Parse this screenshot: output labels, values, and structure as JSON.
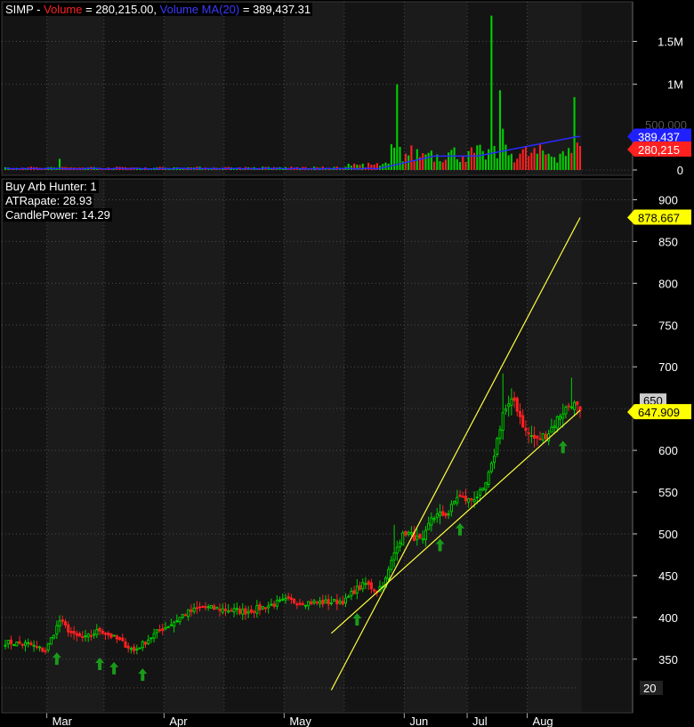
{
  "header": {
    "symbol": "SIMP",
    "sep": " - ",
    "volume_label": "Volume",
    "eq1": " = ",
    "volume_value": "280,215.00",
    "comma": ", ",
    "ma_label": "Volume MA(20)",
    "eq2": " = ",
    "ma_value": "389,437.31"
  },
  "indicators": {
    "buy_arb": "Buy Arb Hunter: 1",
    "atr": "ATRapate: 28.93",
    "candle": "CandlePower: 14.29"
  },
  "colors": {
    "up": "#00d000",
    "down": "#ff2020",
    "ma": "#2a2aff",
    "trend": "#ffff40",
    "arrow": "#1a9a1a",
    "grid": "#4a4a4a",
    "pane_bg": "#141414",
    "alt_bg": "#1b1b1b",
    "tag_last": "#ffff00",
    "tag_vol_up": "#ff2020",
    "tag_ma": "#2020ff"
  },
  "chart_data": [
    {
      "type": "bar",
      "title": "Volume",
      "y_ticks": [
        "1.5M",
        "1M",
        "0"
      ],
      "y_tick_values": [
        1500000,
        1000000,
        0
      ],
      "ylim": [
        0,
        1900000
      ],
      "series": [
        {
          "name": "Volume",
          "last": 280215
        },
        {
          "name": "Volume MA(20)",
          "last": 389437.31
        }
      ],
      "tags": {
        "partial": "500,000",
        "ma": "389,437",
        "vol": "280,215"
      },
      "note_values": {
        "vol_ma_start": 10000,
        "vol_ma_end": 389437
      }
    },
    {
      "type": "candlestick",
      "y_ticks": [
        "900",
        "850",
        "800",
        "750",
        "700",
        "650",
        "600",
        "550",
        "500",
        "450",
        "400",
        "350"
      ],
      "y_tick_values": [
        900,
        850,
        800,
        750,
        700,
        650,
        600,
        550,
        500,
        450,
        400,
        350
      ],
      "ylim": [
        305,
        925
      ],
      "x_labels": [
        "Mar",
        "Apr",
        "May",
        "Jun",
        "Jul",
        "Aug"
      ],
      "last_close": 647.909,
      "upper_trend_end": 878.667,
      "tags": {
        "upper": "878.667",
        "grey": "650",
        "last": "647.909",
        "bottom": "20"
      },
      "anchors": [
        [
          0,
          370
        ],
        [
          8,
          368
        ],
        [
          14,
          360
        ],
        [
          19,
          396
        ],
        [
          24,
          378
        ],
        [
          28,
          375
        ],
        [
          33,
          385
        ],
        [
          40,
          372
        ],
        [
          45,
          360
        ],
        [
          49,
          371
        ],
        [
          54,
          385
        ],
        [
          58,
          392
        ],
        [
          63,
          405
        ],
        [
          69,
          412
        ],
        [
          75,
          410
        ],
        [
          84,
          407
        ],
        [
          90,
          412
        ],
        [
          98,
          420
        ],
        [
          106,
          418
        ],
        [
          113,
          418
        ],
        [
          119,
          420
        ],
        [
          122,
          432
        ],
        [
          126,
          440
        ],
        [
          130,
          432
        ],
        [
          133,
          445
        ],
        [
          137,
          488
        ],
        [
          140,
          502
        ],
        [
          146,
          490
        ],
        [
          149,
          520
        ],
        [
          155,
          525
        ],
        [
          158,
          545
        ],
        [
          162,
          540
        ],
        [
          167,
          550
        ],
        [
          170,
          580
        ],
        [
          174,
          645
        ],
        [
          178,
          660
        ],
        [
          182,
          622
        ],
        [
          186,
          612
        ],
        [
          190,
          622
        ],
        [
          194,
          643
        ],
        [
          198,
          657
        ],
        [
          201,
          648
        ]
      ],
      "arrows_bar_index": [
        18,
        33,
        38,
        48,
        123,
        152,
        159,
        195
      ],
      "trendlines": [
        {
          "name": "upper",
          "from": [
            114,
            313
          ],
          "to": [
            201,
            878.667
          ]
        },
        {
          "name": "lower",
          "from": [
            114,
            381
          ],
          "to": [
            201,
            648
          ]
        }
      ]
    }
  ]
}
